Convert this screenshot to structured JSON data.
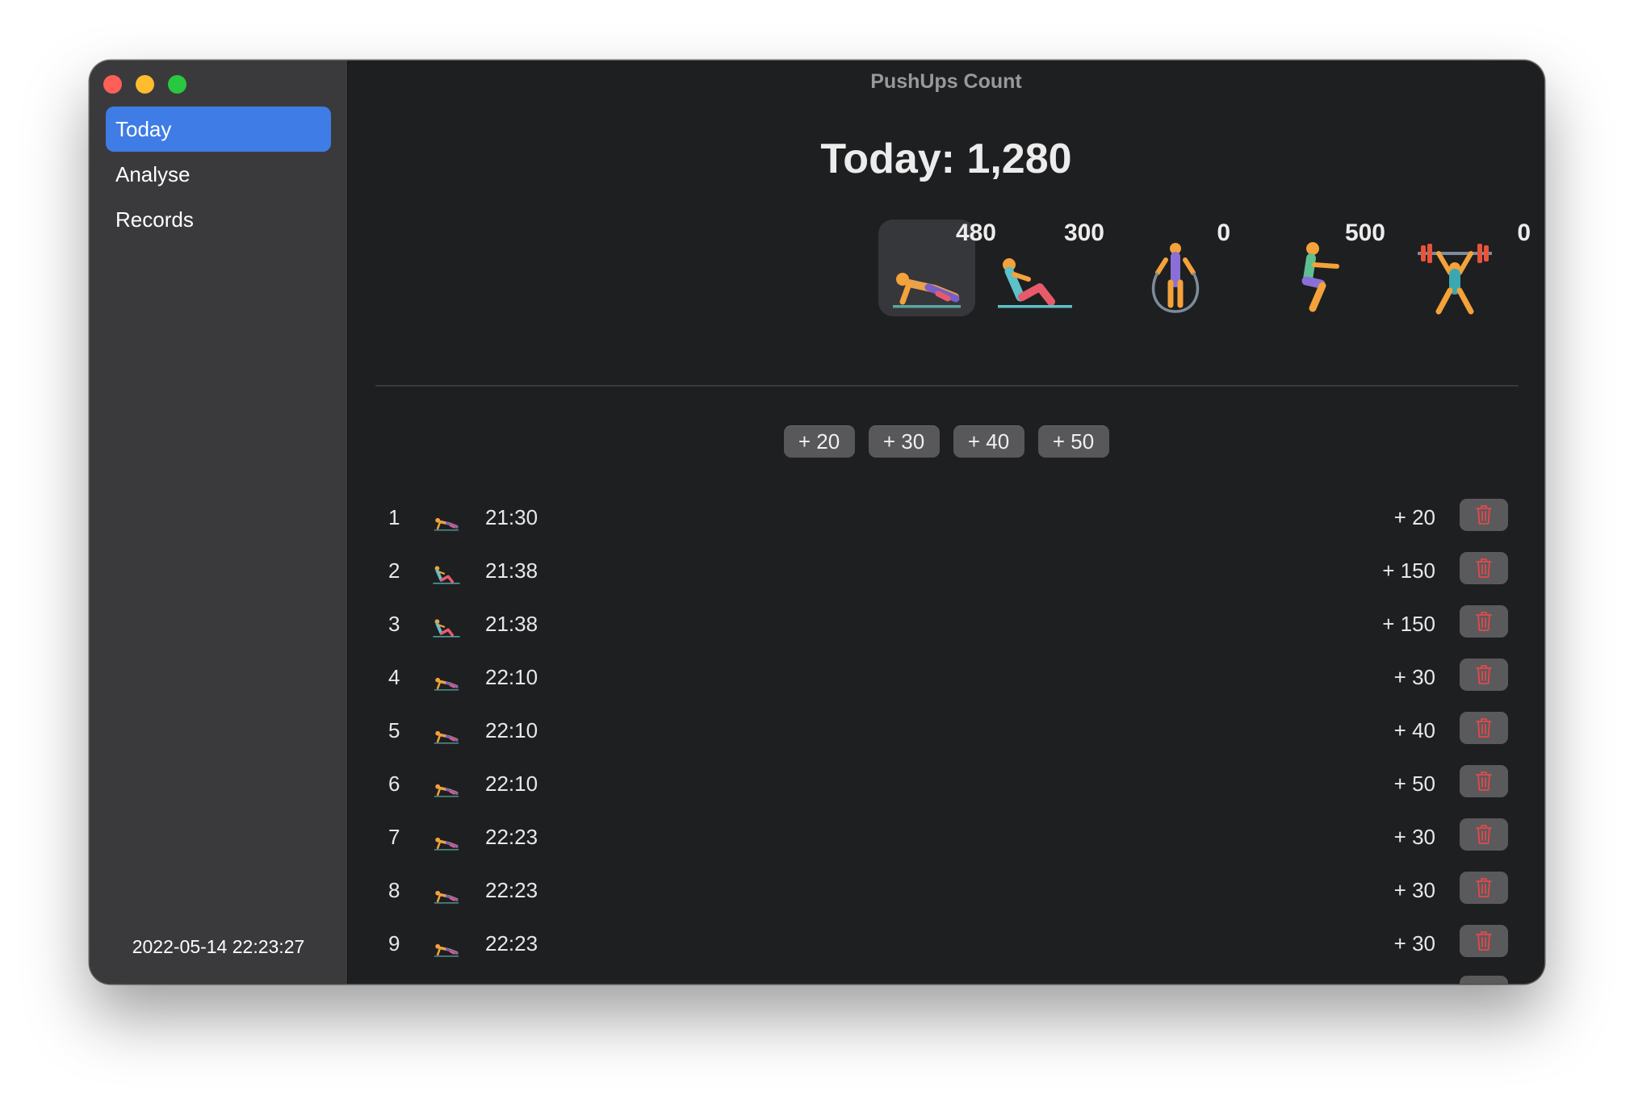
{
  "window": {
    "title": "PushUps Count",
    "traffic_lights": [
      "close",
      "minimize",
      "maximize"
    ]
  },
  "sidebar": {
    "items": [
      {
        "label": "Today",
        "active": true
      },
      {
        "label": "Analyse",
        "active": false
      },
      {
        "label": "Records",
        "active": false
      }
    ],
    "datetime": "2022-05-14 22:23:27",
    "accent_color": "#3f7ce6"
  },
  "main": {
    "today_total": "Today: 1,280",
    "exercises": [
      {
        "icon": "pushup-icon",
        "count": "480",
        "selected": true
      },
      {
        "icon": "situp-icon",
        "count": "300",
        "selected": false
      },
      {
        "icon": "jump-rope-icon",
        "count": "0",
        "selected": false
      },
      {
        "icon": "squat-icon",
        "count": "500",
        "selected": false
      },
      {
        "icon": "weightlifting-icon",
        "count": "0",
        "selected": false
      }
    ],
    "quick_add": [
      "+ 20",
      "+ 30",
      "+ 40",
      "+ 50"
    ],
    "records": [
      {
        "index": "1",
        "icon": "pushup-icon",
        "time": "21:30",
        "amount": "+ 20"
      },
      {
        "index": "2",
        "icon": "situp-icon",
        "time": "21:38",
        "amount": "+ 150"
      },
      {
        "index": "3",
        "icon": "situp-icon",
        "time": "21:38",
        "amount": "+ 150"
      },
      {
        "index": "4",
        "icon": "pushup-icon",
        "time": "22:10",
        "amount": "+ 30"
      },
      {
        "index": "5",
        "icon": "pushup-icon",
        "time": "22:10",
        "amount": "+ 40"
      },
      {
        "index": "6",
        "icon": "pushup-icon",
        "time": "22:10",
        "amount": "+ 50"
      },
      {
        "index": "7",
        "icon": "pushup-icon",
        "time": "22:23",
        "amount": "+ 30"
      },
      {
        "index": "8",
        "icon": "pushup-icon",
        "time": "22:23",
        "amount": "+ 30"
      },
      {
        "index": "9",
        "icon": "pushup-icon",
        "time": "22:23",
        "amount": "+ 30"
      }
    ],
    "delete_icon": "trash-icon",
    "delete_color": "#e5484d"
  }
}
